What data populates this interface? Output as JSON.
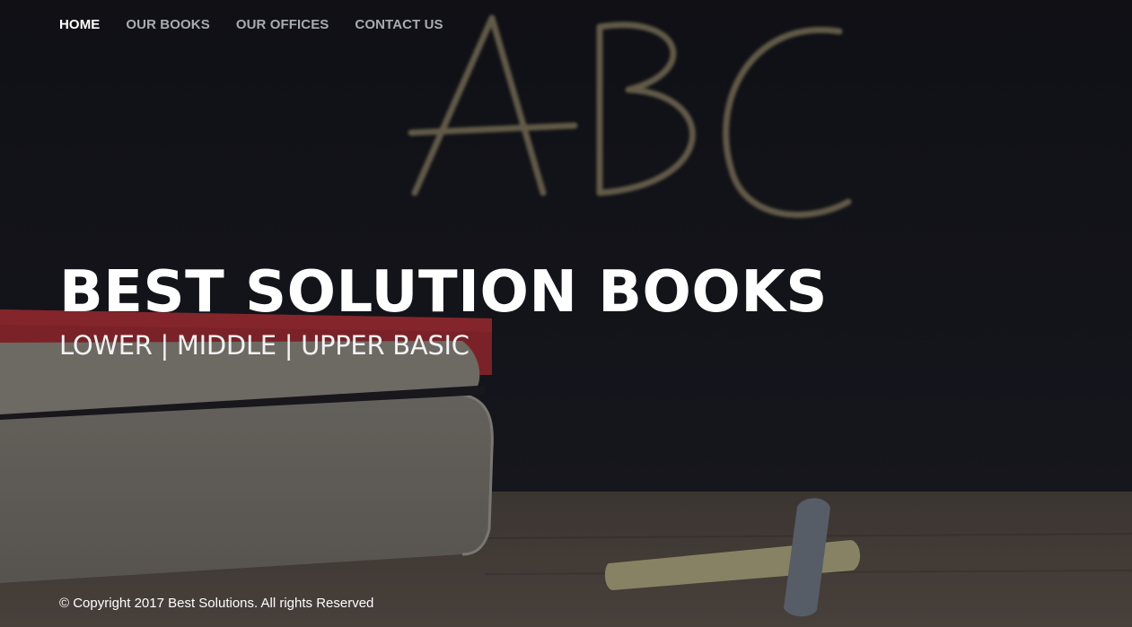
{
  "nav": {
    "items": [
      {
        "label": "HOME",
        "active": true
      },
      {
        "label": "OUR BOOKS",
        "active": false
      },
      {
        "label": "OUR OFFICES",
        "active": false
      },
      {
        "label": "CONTACT US",
        "active": false
      }
    ]
  },
  "hero": {
    "chalk_text": "ABC",
    "title": "BEST SOLUTION BOOKS",
    "subtitle": "LOWER | MIDDLE | UPPER BASIC"
  },
  "footer": {
    "copyright": "© Copyright 2017 Best Solutions. All rights Reserved"
  },
  "colors": {
    "chalkboard": "#15161c",
    "desk": "#4e4640",
    "book_red": "#9a2a2f",
    "nav_inactive": "#a9abb2",
    "nav_active": "#ffffff"
  }
}
